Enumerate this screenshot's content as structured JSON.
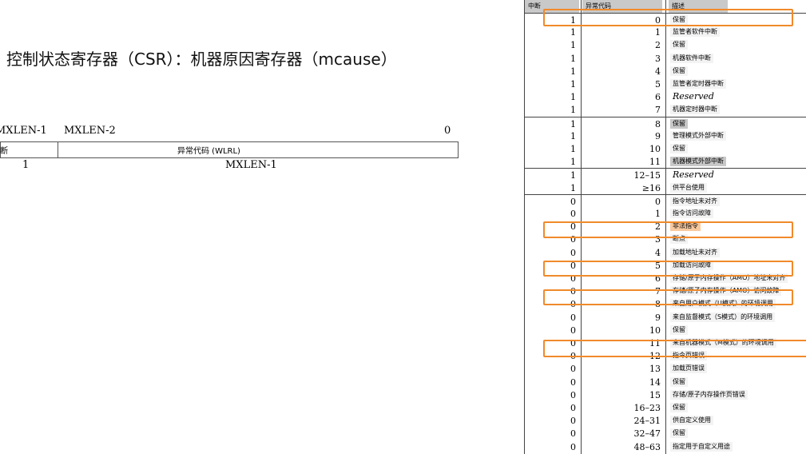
{
  "title": "控制状态寄存器（CSR）：机器原因寄存器（mcause）",
  "register": {
    "bit_left": "MXLEN-1",
    "bit_left2": "MXLEN-2",
    "bit_right": "0",
    "field_interrupt": "断",
    "field_code": "异常代码 (WLRL)",
    "width_interrupt": "1",
    "width_code": "MXLEN-1"
  },
  "table": {
    "headers": [
      "中断",
      "异常代码",
      "描述"
    ],
    "rows": [
      {
        "interrupt": "1",
        "code": "0",
        "desc": "保留"
      },
      {
        "interrupt": "1",
        "code": "1",
        "desc": "监管者软件中断"
      },
      {
        "interrupt": "1",
        "code": "2",
        "desc": "保留"
      },
      {
        "interrupt": "1",
        "code": "3",
        "desc": "机器软件中断"
      },
      {
        "interrupt": "1",
        "code": "4",
        "desc": "保留"
      },
      {
        "interrupt": "1",
        "code": "5",
        "desc": "监管者定时器中断"
      },
      {
        "interrupt": "1",
        "code": "6",
        "desc": "Reserved"
      },
      {
        "interrupt": "1",
        "code": "7",
        "desc": "机器定时器中断"
      },
      {
        "interrupt": "1",
        "code": "8",
        "desc": "保留"
      },
      {
        "interrupt": "1",
        "code": "9",
        "desc": "管理模式外部中断"
      },
      {
        "interrupt": "1",
        "code": "10",
        "desc": "保留"
      },
      {
        "interrupt": "1",
        "code": "11",
        "desc": "机器模式外部中断"
      },
      {
        "interrupt": "1",
        "code": "12–15",
        "desc": "Reserved"
      },
      {
        "interrupt": "1",
        "code": "≥16",
        "desc": "供平台使用"
      },
      {
        "interrupt": "0",
        "code": "0",
        "desc": "指令地址未对齐"
      },
      {
        "interrupt": "0",
        "code": "1",
        "desc": "指令访问故障"
      },
      {
        "interrupt": "0",
        "code": "2",
        "desc": "非法指令"
      },
      {
        "interrupt": "0",
        "code": "3",
        "desc": "断点"
      },
      {
        "interrupt": "0",
        "code": "4",
        "desc": "加载地址未对齐"
      },
      {
        "interrupt": "0",
        "code": "5",
        "desc": "加载访问故障"
      },
      {
        "interrupt": "0",
        "code": "6",
        "desc": "存储/原子内存操作（AMO）地址未对齐"
      },
      {
        "interrupt": "0",
        "code": "7",
        "desc": "存储/原子内存操作（AMO）访问故障"
      },
      {
        "interrupt": "0",
        "code": "8",
        "desc": "来自用户模式（U模式）的环境调用"
      },
      {
        "interrupt": "0",
        "code": "9",
        "desc": "来自监督模式（S模式）的环境调用"
      },
      {
        "interrupt": "0",
        "code": "10",
        "desc": "保留"
      },
      {
        "interrupt": "0",
        "code": "11",
        "desc": "来自机器模式（M模式）的环境调用"
      },
      {
        "interrupt": "0",
        "code": "12",
        "desc": "指令页错误"
      },
      {
        "interrupt": "0",
        "code": "13",
        "desc": "加载页错误"
      },
      {
        "interrupt": "0",
        "code": "14",
        "desc": "保留"
      },
      {
        "interrupt": "0",
        "code": "15",
        "desc": "存储/原子内存操作页错误"
      },
      {
        "interrupt": "0",
        "code": "16–23",
        "desc": "保留"
      },
      {
        "interrupt": "0",
        "code": "24–31",
        "desc": "供自定义使用"
      },
      {
        "interrupt": "0",
        "code": "32–47",
        "desc": "保留"
      },
      {
        "interrupt": "0",
        "code": "48–63",
        "desc": "指定用于自定义用途"
      }
    ]
  },
  "colors": {
    "highlight_box": "#f08a2a",
    "highlight_fill_orange": "#f8c99e",
    "highlight_fill_grey": "#c8c8c8",
    "header_fill": "#c9c9c9"
  }
}
